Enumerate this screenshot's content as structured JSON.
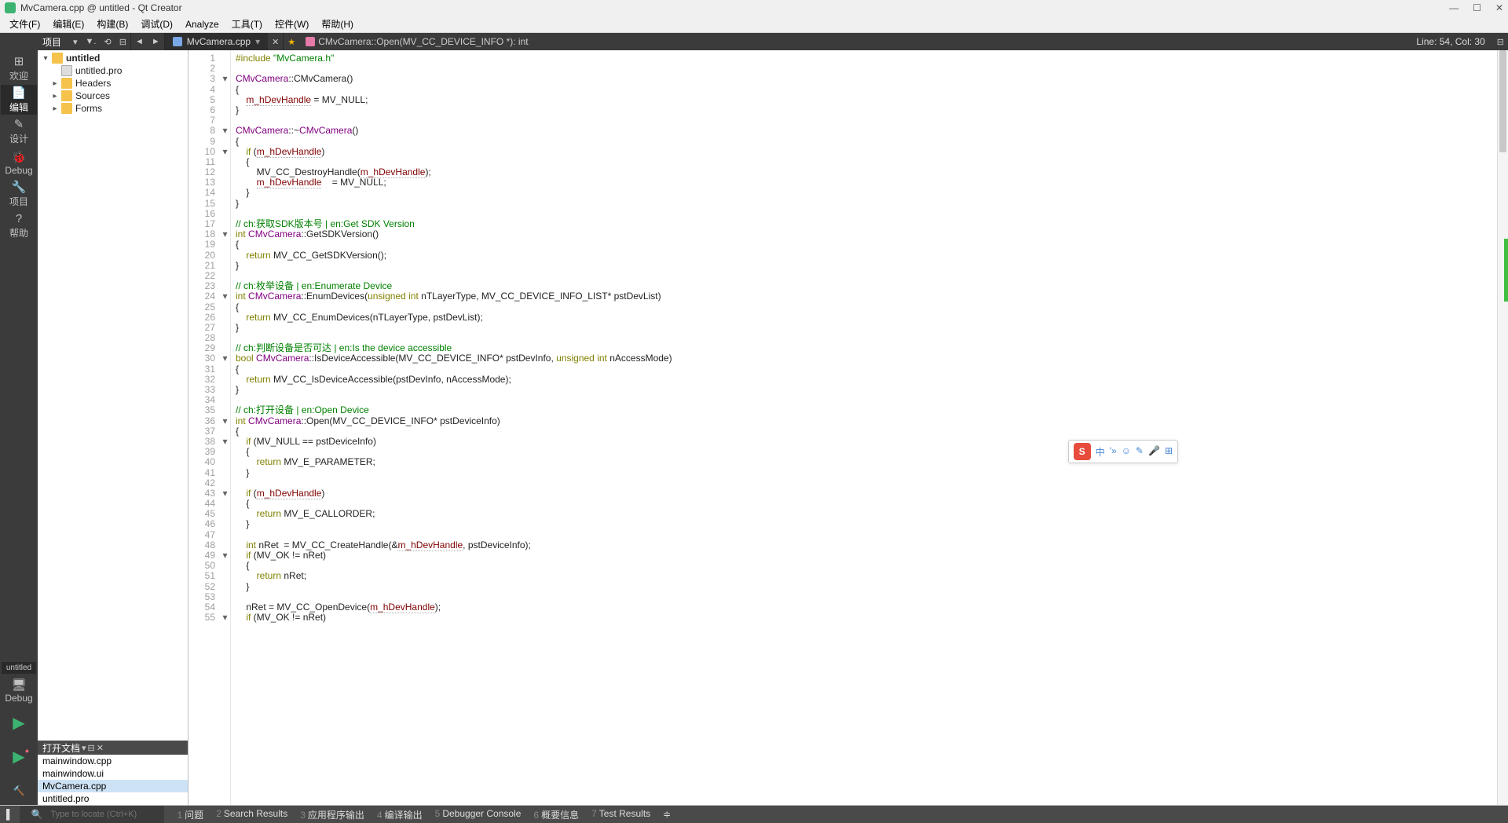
{
  "title": "MvCamera.cpp @ untitled - Qt Creator",
  "menus": [
    "文件(F)",
    "编辑(E)",
    "构建(B)",
    "调试(D)",
    "Analyze",
    "工具(T)",
    "控件(W)",
    "帮助(H)"
  ],
  "nav": {
    "proj": "项目",
    "file": "MvCamera.cpp",
    "crumb": "CMvCamera::Open(MV_CC_DEVICE_INFO *): int",
    "linecol": "Line: 54, Col: 30"
  },
  "dock": [
    {
      "label": "欢迎",
      "icon": "⊞"
    },
    {
      "label": "编辑",
      "icon": "📄",
      "active": true
    },
    {
      "label": "设计",
      "icon": "✎"
    },
    {
      "label": "Debug",
      "icon": "🐞"
    },
    {
      "label": "项目",
      "icon": "🔧"
    },
    {
      "label": "帮助",
      "icon": "?"
    }
  ],
  "dock_proj": "untitled",
  "tree": [
    {
      "d": 0,
      "arrow": "▾",
      "icon": "folder",
      "label": "untitled",
      "bold": true
    },
    {
      "d": 1,
      "arrow": "",
      "icon": "file",
      "label": "untitled.pro"
    },
    {
      "d": 1,
      "arrow": "▸",
      "icon": "folder",
      "label": "Headers"
    },
    {
      "d": 1,
      "arrow": "▸",
      "icon": "folder",
      "label": "Sources"
    },
    {
      "d": 1,
      "arrow": "▸",
      "icon": "folder",
      "label": "Forms"
    }
  ],
  "open_docs_hdr": "打开文档",
  "open_docs": [
    {
      "name": "mainwindow.cpp"
    },
    {
      "name": "mainwindow.ui"
    },
    {
      "name": "MvCamera.cpp",
      "active": true
    },
    {
      "name": "untitled.pro"
    }
  ],
  "code": [
    {
      "n": 1,
      "f": "",
      "t": [
        [
          "kw",
          "#include "
        ],
        [
          "str",
          "\"MvCamera.h\""
        ]
      ]
    },
    {
      "n": 2,
      "f": "",
      "t": [
        [
          "",
          ""
        ]
      ]
    },
    {
      "n": 3,
      "f": "▾",
      "t": [
        [
          "ty",
          "CMvCamera"
        ],
        [
          "",
          "::CMvCamera()"
        ]
      ]
    },
    {
      "n": 4,
      "f": "",
      "t": [
        [
          "",
          "{"
        ]
      ]
    },
    {
      "n": 5,
      "f": "",
      "t": [
        [
          "",
          "    "
        ],
        [
          "mem",
          "m_hDevHandle"
        ],
        [
          "",
          " = MV_NULL;"
        ]
      ]
    },
    {
      "n": 6,
      "f": "",
      "t": [
        [
          "",
          "}"
        ]
      ]
    },
    {
      "n": 7,
      "f": "",
      "t": [
        [
          "",
          ""
        ]
      ]
    },
    {
      "n": 8,
      "f": "▾",
      "t": [
        [
          "ty",
          "CMvCamera"
        ],
        [
          "",
          "::~"
        ],
        [
          "ty",
          "CMvCamera"
        ],
        [
          "",
          "()"
        ]
      ]
    },
    {
      "n": 9,
      "f": "",
      "t": [
        [
          "",
          "{"
        ]
      ]
    },
    {
      "n": 10,
      "f": "▾",
      "t": [
        [
          "",
          "    "
        ],
        [
          "kw",
          "if"
        ],
        [
          "",
          " ("
        ],
        [
          "mem",
          "m_hDevHandle"
        ],
        [
          "",
          ")"
        ]
      ]
    },
    {
      "n": 11,
      "f": "",
      "t": [
        [
          "",
          "    {"
        ]
      ]
    },
    {
      "n": 12,
      "f": "",
      "t": [
        [
          "",
          "        MV_CC_DestroyHandle("
        ],
        [
          "mem",
          "m_hDevHandle"
        ],
        [
          "",
          ");"
        ]
      ]
    },
    {
      "n": 13,
      "f": "",
      "t": [
        [
          "",
          "        "
        ],
        [
          "mem",
          "m_hDevHandle"
        ],
        [
          "",
          "    = MV_NULL;"
        ]
      ]
    },
    {
      "n": 14,
      "f": "",
      "t": [
        [
          "",
          "    }"
        ]
      ]
    },
    {
      "n": 15,
      "f": "",
      "t": [
        [
          "",
          "}"
        ]
      ]
    },
    {
      "n": 16,
      "f": "",
      "t": [
        [
          "",
          ""
        ]
      ]
    },
    {
      "n": 17,
      "f": "",
      "t": [
        [
          "cm",
          "// ch:获取SDK版本号 | en:Get SDK Version"
        ]
      ]
    },
    {
      "n": 18,
      "f": "▾",
      "t": [
        [
          "kw",
          "int"
        ],
        [
          "",
          " "
        ],
        [
          "ty",
          "CMvCamera"
        ],
        [
          "",
          "::GetSDKVersion()"
        ]
      ]
    },
    {
      "n": 19,
      "f": "",
      "t": [
        [
          "",
          "{"
        ]
      ]
    },
    {
      "n": 20,
      "f": "",
      "t": [
        [
          "",
          "    "
        ],
        [
          "kw",
          "return"
        ],
        [
          "",
          " MV_CC_GetSDKVersion();"
        ]
      ]
    },
    {
      "n": 21,
      "f": "",
      "t": [
        [
          "",
          "}"
        ]
      ]
    },
    {
      "n": 22,
      "f": "",
      "t": [
        [
          "",
          ""
        ]
      ]
    },
    {
      "n": 23,
      "f": "",
      "t": [
        [
          "cm",
          "// ch:枚举设备 | en:Enumerate Device"
        ]
      ]
    },
    {
      "n": 24,
      "f": "▾",
      "t": [
        [
          "kw",
          "int"
        ],
        [
          "",
          " "
        ],
        [
          "ty",
          "CMvCamera"
        ],
        [
          "",
          "::EnumDevices("
        ],
        [
          "kw",
          "unsigned"
        ],
        [
          "",
          " "
        ],
        [
          "kw",
          "int"
        ],
        [
          "",
          " nTLayerType, MV_CC_DEVICE_INFO_LIST* pstDevList)"
        ]
      ]
    },
    {
      "n": 25,
      "f": "",
      "t": [
        [
          "",
          "{"
        ]
      ]
    },
    {
      "n": 26,
      "f": "",
      "t": [
        [
          "",
          "    "
        ],
        [
          "kw",
          "return"
        ],
        [
          "",
          " MV_CC_EnumDevices(nTLayerType, pstDevList);"
        ]
      ]
    },
    {
      "n": 27,
      "f": "",
      "t": [
        [
          "",
          "}"
        ]
      ]
    },
    {
      "n": 28,
      "f": "",
      "t": [
        [
          "",
          ""
        ]
      ]
    },
    {
      "n": 29,
      "f": "",
      "t": [
        [
          "cm",
          "// ch:判断设备是否可达 | en:Is the device accessible"
        ]
      ]
    },
    {
      "n": 30,
      "f": "▾",
      "t": [
        [
          "kw",
          "bool"
        ],
        [
          "",
          " "
        ],
        [
          "ty",
          "CMvCamera"
        ],
        [
          "",
          "::IsDeviceAccessible(MV_CC_DEVICE_INFO* pstDevInfo, "
        ],
        [
          "kw",
          "unsigned"
        ],
        [
          "",
          " "
        ],
        [
          "kw",
          "int"
        ],
        [
          "",
          " nAccessMode)"
        ]
      ]
    },
    {
      "n": 31,
      "f": "",
      "t": [
        [
          "",
          "{"
        ]
      ]
    },
    {
      "n": 32,
      "f": "",
      "t": [
        [
          "",
          "    "
        ],
        [
          "kw",
          "return"
        ],
        [
          "",
          " MV_CC_IsDeviceAccessible(pstDevInfo, nAccessMode);"
        ]
      ]
    },
    {
      "n": 33,
      "f": "",
      "t": [
        [
          "",
          "}"
        ]
      ]
    },
    {
      "n": 34,
      "f": "",
      "t": [
        [
          "",
          ""
        ]
      ]
    },
    {
      "n": 35,
      "f": "",
      "t": [
        [
          "cm",
          "// ch:打开设备 | en:Open Device"
        ]
      ]
    },
    {
      "n": 36,
      "f": "▾",
      "t": [
        [
          "kw",
          "int"
        ],
        [
          "",
          " "
        ],
        [
          "ty",
          "CMvCamera"
        ],
        [
          "",
          "::Open(MV_CC_DEVICE_INFO* pstDeviceInfo)"
        ]
      ]
    },
    {
      "n": 37,
      "f": "",
      "t": [
        [
          "",
          "{"
        ]
      ]
    },
    {
      "n": 38,
      "f": "▾",
      "t": [
        [
          "",
          "    "
        ],
        [
          "kw",
          "if"
        ],
        [
          "",
          " (MV_NULL == pstDeviceInfo)"
        ]
      ]
    },
    {
      "n": 39,
      "f": "",
      "t": [
        [
          "",
          "    {"
        ]
      ]
    },
    {
      "n": 40,
      "f": "",
      "t": [
        [
          "",
          "        "
        ],
        [
          "kw",
          "return"
        ],
        [
          "",
          " MV_E_PARAMETER;"
        ]
      ]
    },
    {
      "n": 41,
      "f": "",
      "t": [
        [
          "",
          "    }"
        ]
      ]
    },
    {
      "n": 42,
      "f": "",
      "t": [
        [
          "",
          ""
        ]
      ]
    },
    {
      "n": 43,
      "f": "▾",
      "t": [
        [
          "",
          "    "
        ],
        [
          "kw",
          "if"
        ],
        [
          "",
          " ("
        ],
        [
          "mem",
          "m_hDevHandle"
        ],
        [
          "",
          ")"
        ]
      ]
    },
    {
      "n": 44,
      "f": "",
      "t": [
        [
          "",
          "    {"
        ]
      ]
    },
    {
      "n": 45,
      "f": "",
      "t": [
        [
          "",
          "        "
        ],
        [
          "kw",
          "return"
        ],
        [
          "",
          " MV_E_CALLORDER;"
        ]
      ]
    },
    {
      "n": 46,
      "f": "",
      "t": [
        [
          "",
          "    }"
        ]
      ]
    },
    {
      "n": 47,
      "f": "",
      "t": [
        [
          "",
          ""
        ]
      ]
    },
    {
      "n": 48,
      "f": "",
      "t": [
        [
          "",
          "    "
        ],
        [
          "kw",
          "int"
        ],
        [
          "",
          " nRet  = MV_CC_CreateHandle(&"
        ],
        [
          "mem",
          "m_hDevHandle"
        ],
        [
          "",
          ", pstDeviceInfo);"
        ]
      ]
    },
    {
      "n": 49,
      "f": "▾",
      "t": [
        [
          "",
          "    "
        ],
        [
          "kw",
          "if"
        ],
        [
          "",
          " (MV_OK != nRet)"
        ]
      ]
    },
    {
      "n": 50,
      "f": "",
      "t": [
        [
          "",
          "    {"
        ]
      ]
    },
    {
      "n": 51,
      "f": "",
      "t": [
        [
          "",
          "        "
        ],
        [
          "kw",
          "return"
        ],
        [
          "",
          " nRet;"
        ]
      ]
    },
    {
      "n": 52,
      "f": "",
      "t": [
        [
          "",
          "    }"
        ]
      ]
    },
    {
      "n": 53,
      "f": "",
      "t": [
        [
          "",
          ""
        ]
      ]
    },
    {
      "n": 54,
      "f": "",
      "t": [
        [
          "",
          "    nRet = MV_CC_OpenDevice("
        ],
        [
          "mem",
          "m_hDevHandle"
        ],
        [
          "",
          ");"
        ]
      ]
    },
    {
      "n": 55,
      "f": "▾",
      "t": [
        [
          "",
          "    "
        ],
        [
          "kw",
          "if"
        ],
        [
          "",
          " (MV_OK != nRet)"
        ]
      ]
    }
  ],
  "locator_placeholder": "Type to locate (Ctrl+K)",
  "panes": [
    {
      "n": "1",
      "t": "问题"
    },
    {
      "n": "2",
      "t": "Search Results"
    },
    {
      "n": "3",
      "t": "应用程序输出"
    },
    {
      "n": "4",
      "t": "编译输出"
    },
    {
      "n": "5",
      "t": "Debugger Console"
    },
    {
      "n": "6",
      "t": "概要信息"
    },
    {
      "n": "7",
      "t": "Test Results"
    }
  ],
  "ime": [
    "中",
    "'»",
    "☺",
    "✎",
    "🎤",
    "⊞"
  ]
}
